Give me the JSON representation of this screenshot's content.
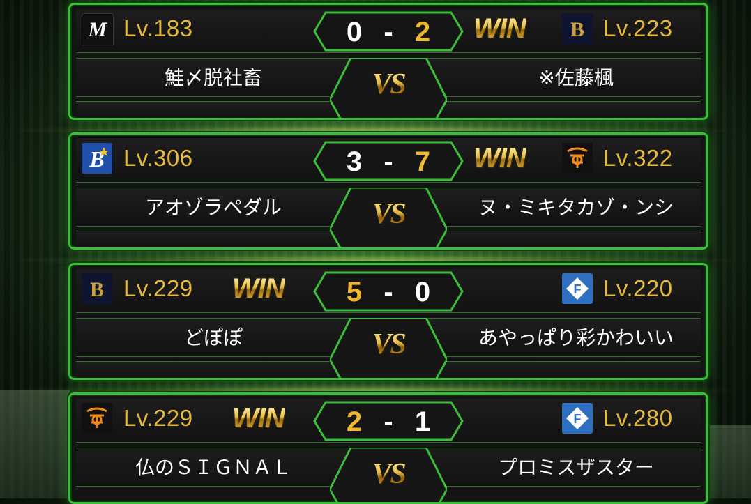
{
  "matches": [
    {
      "left": {
        "team_icon": "marines-logo-icon",
        "level": "Lv.183",
        "player": "鮭〆脱社畜"
      },
      "right": {
        "team_icon": "buffaloes-logo-icon",
        "level": "Lv.223",
        "player": "※佐藤楓"
      },
      "score_left": "0",
      "score_right": "2",
      "separator": "-",
      "winner": "right",
      "win_label": "WIN",
      "vs_label": "VS"
    },
    {
      "left": {
        "team_icon": "baystars-logo-icon",
        "level": "Lv.306",
        "player": "アオゾラペダル"
      },
      "right": {
        "team_icon": "giants-logo-icon",
        "level": "Lv.322",
        "player": "ヌ・ミキタカゾ・ンシ"
      },
      "score_left": "3",
      "score_right": "7",
      "separator": "-",
      "winner": "right",
      "win_label": "WIN",
      "vs_label": "VS"
    },
    {
      "left": {
        "team_icon": "buffaloes-logo-icon",
        "level": "Lv.229",
        "player": "どぽぽ"
      },
      "right": {
        "team_icon": "fighters-logo-icon",
        "level": "Lv.220",
        "player": "あやっぱり彩かわいい"
      },
      "score_left": "5",
      "score_right": "0",
      "separator": "-",
      "winner": "left",
      "win_label": "WIN",
      "vs_label": "VS"
    },
    {
      "left": {
        "team_icon": "giants-logo-icon",
        "level": "Lv.229",
        "player": "仏のＳＩＧＮＡＬ"
      },
      "right": {
        "team_icon": "fighters-logo-icon",
        "level": "Lv.280",
        "player": "プロミスザスター"
      },
      "score_left": "2",
      "score_right": "1",
      "separator": "-",
      "winner": "left",
      "win_label": "WIN",
      "vs_label": "VS"
    }
  ],
  "colors": {
    "frame": "#3bbd3a",
    "level_text": "#e5b93e",
    "winner_score": "#efb62e",
    "loser_score": "#ffffff"
  }
}
